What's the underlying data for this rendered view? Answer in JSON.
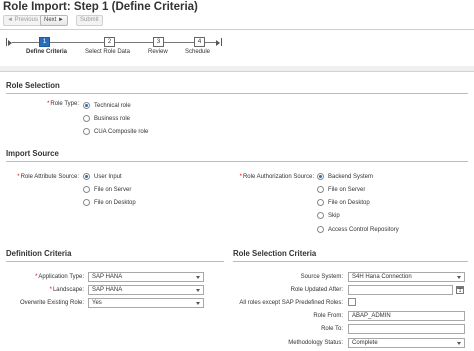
{
  "header": {
    "title": "Role Import: Step 1  (Define Criteria)"
  },
  "toolbar": {
    "previous_label": "◄ Previous",
    "next_label": "Next ►",
    "submit_label": "Submit"
  },
  "roadmap": {
    "steps": [
      {
        "number": "1",
        "label": "Define Criteria",
        "active": true
      },
      {
        "number": "2",
        "label": "Select Role Data",
        "active": false
      },
      {
        "number": "3",
        "label": "Review",
        "active": false
      },
      {
        "number": "4",
        "label": "Schedule",
        "active": false
      }
    ]
  },
  "role_selection": {
    "title": "Role Selection",
    "role_type_label": "Role Type:",
    "options": [
      "Technical role",
      "Business role",
      "CUA Composite role"
    ],
    "selected": "Technical role"
  },
  "import_source": {
    "title": "Import Source",
    "attribute_source_label": "Role Attribute Source:",
    "attribute_options": [
      "User Input",
      "File on Server",
      "File on Desktop"
    ],
    "attribute_selected": "User Input",
    "authorization_source_label": "Role Authorization Source:",
    "authorization_options": [
      "Backend System",
      "File on Server",
      "File on Desktop",
      "Skip",
      "Access Control Repository"
    ],
    "authorization_selected": "Backend System"
  },
  "definition_criteria": {
    "title": "Definition Criteria",
    "application_type_label": "Application Type:",
    "application_type_value": "SAP HANA",
    "landscape_label": "Landscape:",
    "landscape_value": "SAP HANA",
    "overwrite_label": "Overwrite Existing Role:",
    "overwrite_value": "Yes"
  },
  "role_selection_criteria": {
    "title": "Role Selection Criteria",
    "source_system_label": "Source System:",
    "source_system_value": "S4H Hana Connection",
    "role_updated_after_label": "Role Updated After:",
    "role_updated_after_value": "",
    "calendar_glyph": "1",
    "all_roles_label": "All roles except SAP Predefined Roles:",
    "role_from_label": "Role From:",
    "role_from_value": "ABAP_ADMIN",
    "role_to_label": "Role To:",
    "role_to_value": "",
    "methodology_label": "Methodology Status:",
    "methodology_value": "Complete"
  },
  "colors": {
    "accent": "#2a6ebb",
    "required": "#dd0000"
  }
}
